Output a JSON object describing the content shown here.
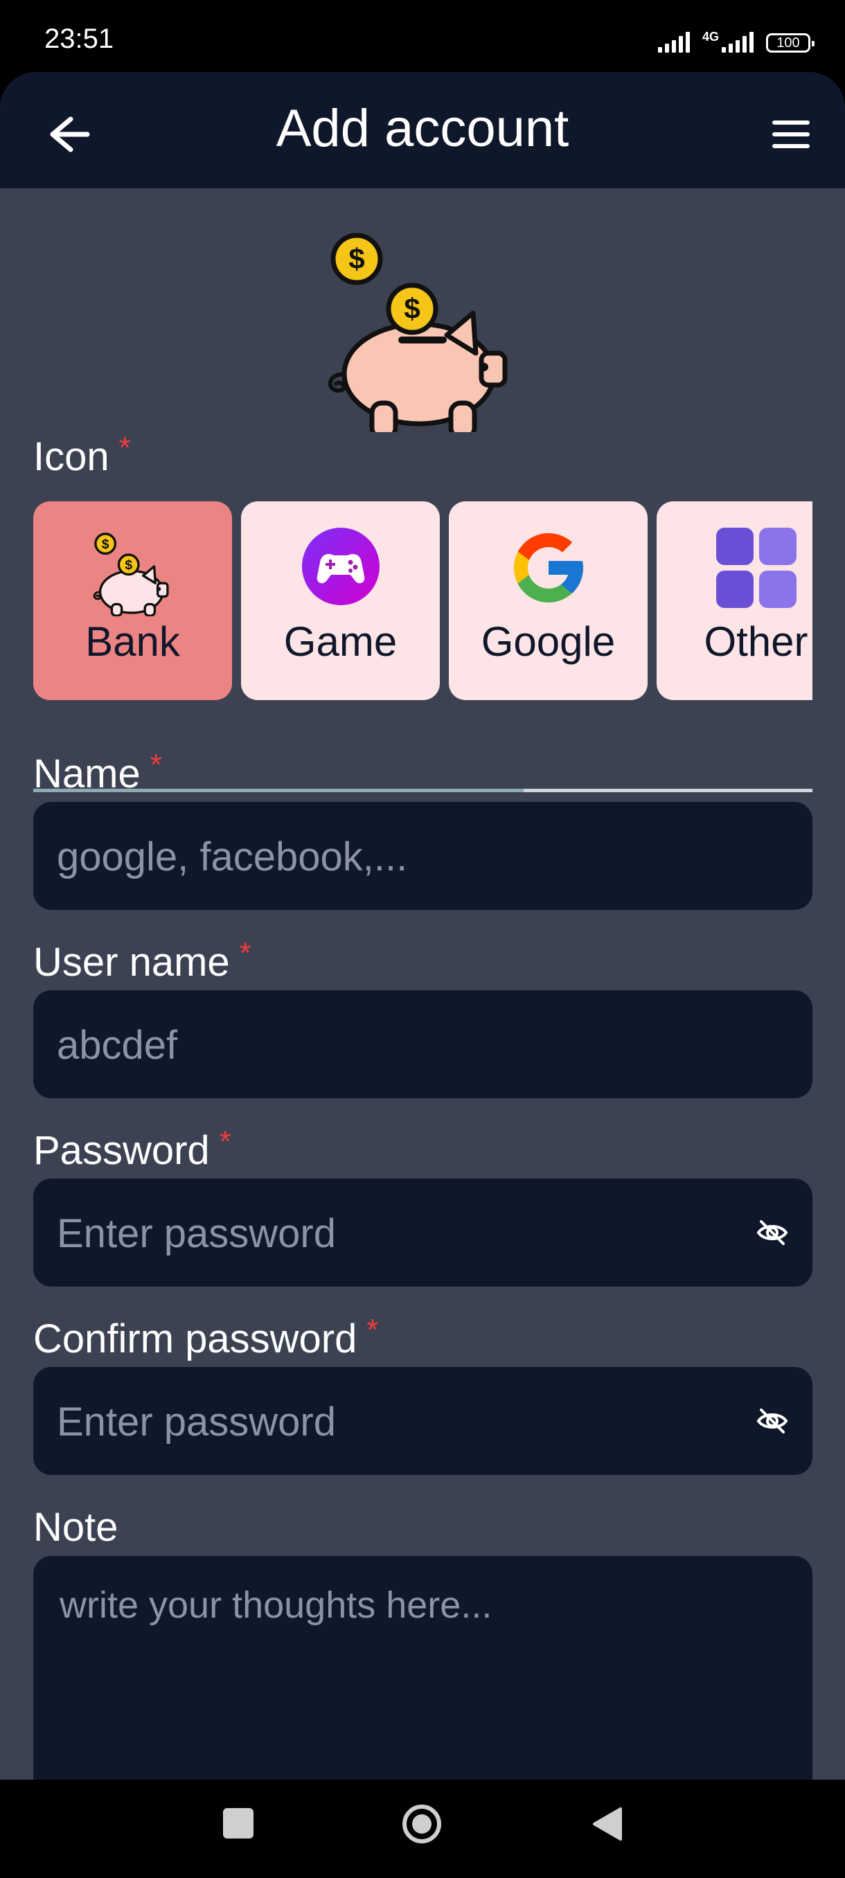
{
  "status_bar": {
    "time": "23:51",
    "network": "4G",
    "battery": "100"
  },
  "appbar": {
    "title": "Add account",
    "back_icon": "arrow-left-icon",
    "menu_icon": "hamburger-menu-icon"
  },
  "icon_section": {
    "label": "Icon",
    "required": "*",
    "selected": "Bank",
    "options": [
      {
        "label": "Bank",
        "icon": "piggy-bank-icon"
      },
      {
        "label": "Game",
        "icon": "gamepad-icon"
      },
      {
        "label": "Google",
        "icon": "google-logo-icon"
      },
      {
        "label": "Other",
        "icon": "grid-icon"
      }
    ]
  },
  "form": {
    "name": {
      "label": "Name",
      "required": "*",
      "placeholder": "google, facebook,..."
    },
    "username": {
      "label": "User name",
      "required": "*",
      "placeholder": "abcdef"
    },
    "password": {
      "label": "Password",
      "required": "*",
      "placeholder": "Enter password"
    },
    "confirm_password": {
      "label": "Confirm password",
      "required": "*",
      "placeholder": "Enter password"
    },
    "note": {
      "label": "Note",
      "placeholder": "write your thoughts here..."
    }
  },
  "colors": {
    "app_bar": "#0f172a",
    "background": "#3c4252",
    "selected_chip": "#ec8484",
    "chip": "#fde4e6",
    "required": "#ef3b3b"
  }
}
